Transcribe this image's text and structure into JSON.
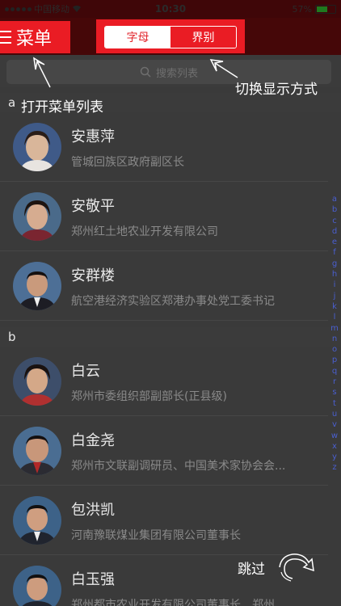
{
  "status_bar": {
    "carrier": "中国移动",
    "time": "10:30",
    "battery_text": "57%",
    "battery_level_fraction": 0.57
  },
  "header": {
    "menu_label": "菜单",
    "segments": [
      {
        "label": "字母",
        "selected": true
      },
      {
        "label": "界别",
        "selected": false
      }
    ]
  },
  "search": {
    "placeholder": "搜索列表"
  },
  "sections": [
    {
      "letter": "a",
      "contacts": [
        {
          "name": "安惠萍",
          "title": "管城回族区政府副区长"
        },
        {
          "name": "安敬平",
          "title": "郑州红土地农业开发有限公司"
        },
        {
          "name": "安群楼",
          "title": "航空港经济实验区郑港办事处党工委书记"
        }
      ]
    },
    {
      "letter": "b",
      "contacts": [
        {
          "name": "白云",
          "title": "郑州市委组织部副部长(正县级)"
        },
        {
          "name": "白金尧",
          "title": "郑州市文联副调研员、中国美术家协会会..."
        },
        {
          "name": "包洪凯",
          "title": "河南豫联煤业集团有限公司董事长"
        },
        {
          "name": "白玉强",
          "title": "郑州都市农业开发有限公司董事长、郑州..."
        }
      ]
    }
  ],
  "index_letters": [
    "a",
    "b",
    "c",
    "d",
    "e",
    "f",
    "g",
    "h",
    "i",
    "j",
    "k",
    "l",
    "m",
    "n",
    "o",
    "p",
    "q",
    "r",
    "s",
    "t",
    "u",
    "v",
    "w",
    "x",
    "y",
    "z"
  ],
  "annotations": {
    "open_menu": "打开菜单列表",
    "switch_mode": "切换显示方式",
    "skip": "跳过"
  },
  "colors": {
    "accent": "#ea1c24",
    "header_dim": "#450708",
    "index_letters": "#4a5fd0"
  }
}
